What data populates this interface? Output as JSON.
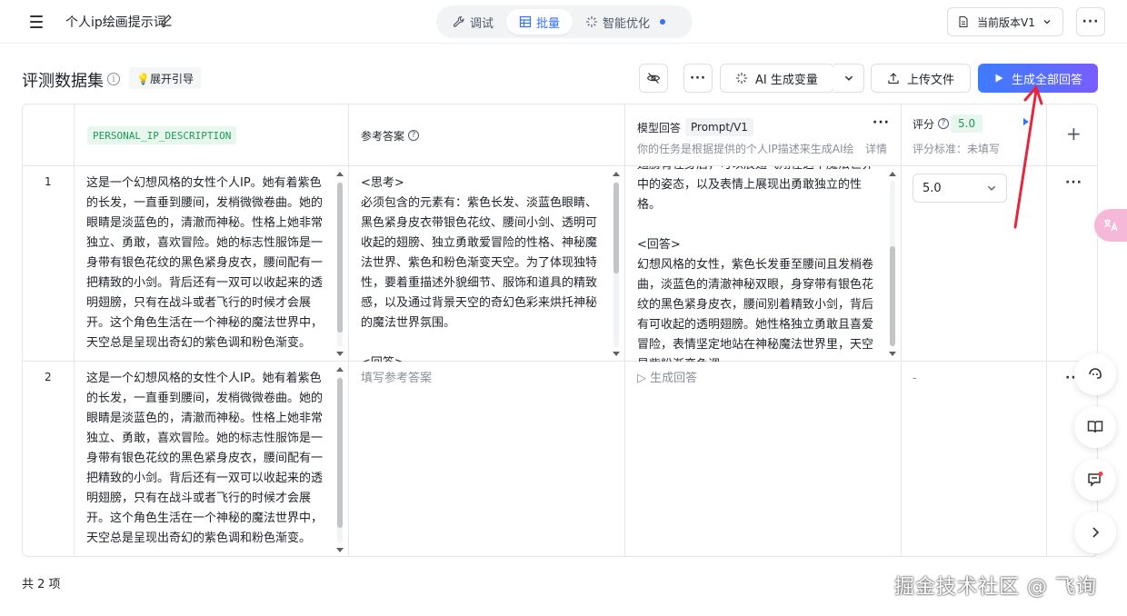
{
  "topbar": {
    "title": "个人ip绘画提示词",
    "tabs": [
      {
        "label": "调试",
        "icon": "wrench-icon"
      },
      {
        "label": "批量",
        "icon": "table-icon"
      },
      {
        "label": "智能优化",
        "icon": "sparkle-icon"
      }
    ],
    "active_tab": "批量",
    "version_label": "当前版本V1"
  },
  "section": {
    "title": "评测数据集",
    "guide_label": "💡展开引导",
    "ai_gen_label": "AI 生成变量",
    "upload_label": "上传文件",
    "generate_all_label": "生成全部回答"
  },
  "table": {
    "headers": {
      "variable": "PERSONAL_IP_DESCRIPTION",
      "reference": "参考答案",
      "model_answer": "模型回答",
      "prompt_version": "Prompt/V1",
      "model_desc": "你的任务是根据提供的个人IP描述来生成AI绘…",
      "detail": "详情",
      "score": "评分",
      "score_value": "5.0",
      "score_criteria": "评分标准：未填写"
    },
    "rows": [
      {
        "index": "1",
        "input": "这是一个幻想风格的女性个人IP。她有着紫色的长发，一直垂到腰间，发梢微微卷曲。她的眼睛是淡蓝色的，清澈而神秘。性格上她非常独立、勇敢，喜欢冒险。她的标志性服饰是一身带有银色花纹的黑色紧身皮衣，腰间配有一把精致的小剑。背后还有一双可以收起来的透明翅膀，只有在战斗或者飞行的时候才会展开。这个角色生活在一个神秘的魔法世界中，天空总是呈现出奇幻的紫色调和粉色渐变。",
        "reference": "<思考>\n必须包含的元素有：紫色长发、淡蓝色眼睛、黑色紧身皮衣带银色花纹、腰间小剑、透明可收起的翅膀、独立勇敢爱冒险的性格、神秘魔法世界、紫色和粉色渐变天空。为了体现独特性，要着重描述外貌细节、服饰和道具的精致感，以及通过背景天空的奇幻色彩来烘托神秘的魔法世界氛围。\n\n<回答>",
        "model_answer": "翅膀背在身后，可以展翅飞翔在这个魔法世界中的姿态，以及表情上展现出勇敢独立的性格。\n\n<回答>\n幻想风格的女性，紫色长发垂至腰间且发梢卷曲，淡蓝色的清澈神秘双眼，身穿带有银色花纹的黑色紧身皮衣，腰间别着精致小剑，背后有可收起的透明翅膀。她性格独立勇敢且喜爱冒险，表情坚定地站在神秘魔法世界里，天空是紫粉渐变色调。",
        "score": "5.0"
      },
      {
        "index": "2",
        "input": "这是一个幻想风格的女性个人IP。她有着紫色的长发，一直垂到腰间，发梢微微卷曲。她的眼睛是淡蓝色的，清澈而神秘。性格上她非常独立、勇敢，喜欢冒险。她的标志性服饰是一身带有银色花纹的黑色紧身皮衣，腰间配有一把精致的小剑。背后还有一双可以收起来的透明翅膀，只有在战斗或者飞行的时候才会展开。这个角色生活在一个神秘的魔法世界中，天空总是呈现出奇幻的紫色调和粉色渐变。",
        "reference_placeholder": "填写参考答案",
        "model_action": "▷ 生成回答",
        "score": "-"
      }
    ]
  },
  "footer": {
    "count": "共 2 项",
    "watermark": "掘金技术社区 @ 飞询"
  },
  "colors": {
    "primary": "#3d7bff",
    "accent_purple": "#7a5cff",
    "tag_green": "#1a9c55",
    "annotation_red": "#e5263d"
  }
}
